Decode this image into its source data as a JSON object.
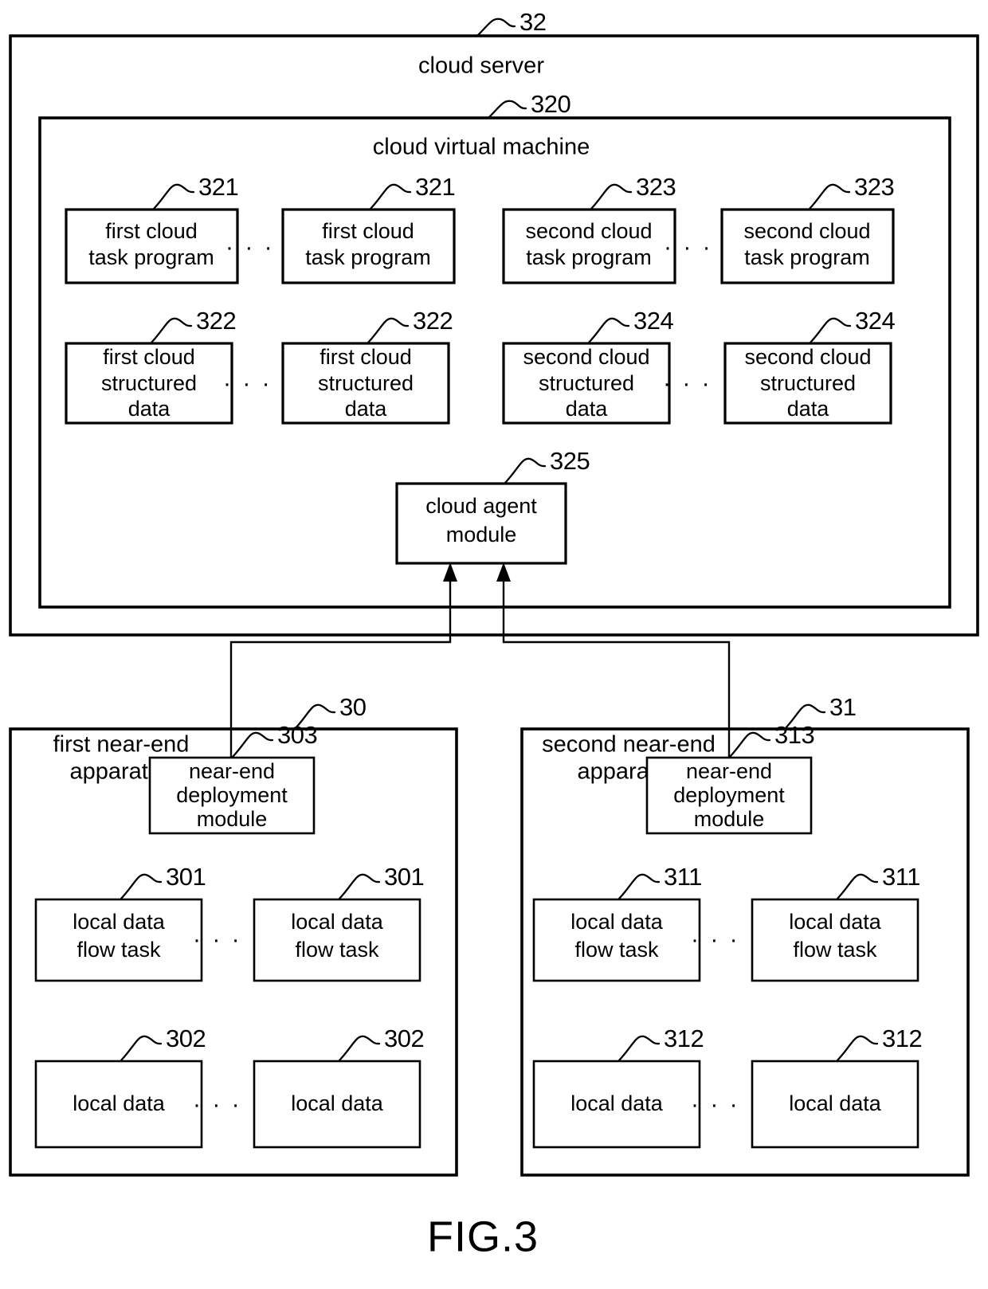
{
  "figure": {
    "caption": "FIG.3"
  },
  "containers": {
    "cloud_server": {
      "label": "cloud server",
      "ref": "32"
    },
    "cloud_virtual_machine": {
      "label": "cloud virtual machine",
      "ref": "320"
    },
    "first_near_end_apparatus": {
      "label_line1": "first near-end",
      "label_line2": "apparatus",
      "ref": "30"
    },
    "second_near_end_apparatus": {
      "label_line1": "second near-end",
      "label_line2": "apparatus",
      "ref": "31"
    }
  },
  "cloud_boxes": {
    "first_task_program_1": {
      "line1": "first cloud",
      "line2": "task program",
      "ref": "321"
    },
    "first_task_program_2": {
      "line1": "first cloud",
      "line2": "task program",
      "ref": "321"
    },
    "second_task_program_1": {
      "line1": "second cloud",
      "line2": "task program",
      "ref": "323"
    },
    "second_task_program_2": {
      "line1": "second cloud",
      "line2": "task program",
      "ref": "323"
    },
    "first_structured_data_1": {
      "line1": "first cloud",
      "line2": "structured",
      "line3": "data",
      "ref": "322"
    },
    "first_structured_data_2": {
      "line1": "first cloud",
      "line2": "structured",
      "line3": "data",
      "ref": "322"
    },
    "second_structured_data_1": {
      "line1": "second cloud",
      "line2": "structured",
      "line3": "data",
      "ref": "324"
    },
    "second_structured_data_2": {
      "line1": "second cloud",
      "line2": "structured",
      "line3": "data",
      "ref": "324"
    },
    "cloud_agent_module": {
      "line1": "cloud agent",
      "line2": "module",
      "ref": "325"
    }
  },
  "first_apparatus_boxes": {
    "deployment_module": {
      "line1": "near-end",
      "line2": "deployment",
      "line3": "module",
      "ref": "303"
    },
    "data_flow_task_1": {
      "line1": "local data",
      "line2": "flow task",
      "ref": "301"
    },
    "data_flow_task_2": {
      "line1": "local data",
      "line2": "flow task",
      "ref": "301"
    },
    "local_data_1": {
      "line1": "local data",
      "ref": "302"
    },
    "local_data_2": {
      "line1": "local data",
      "ref": "302"
    }
  },
  "second_apparatus_boxes": {
    "deployment_module": {
      "line1": "near-end",
      "line2": "deployment",
      "line3": "module",
      "ref": "313"
    },
    "data_flow_task_1": {
      "line1": "local data",
      "line2": "flow task",
      "ref": "311"
    },
    "data_flow_task_2": {
      "line1": "local data",
      "line2": "flow task",
      "ref": "311"
    },
    "local_data_1": {
      "line1": "local data",
      "ref": "312"
    },
    "local_data_2": {
      "line1": "local data",
      "ref": "312"
    }
  },
  "ellipsis": {
    "glyph": "· · · ·"
  },
  "colors": {
    "stroke": "#000000",
    "background": "#ffffff"
  }
}
